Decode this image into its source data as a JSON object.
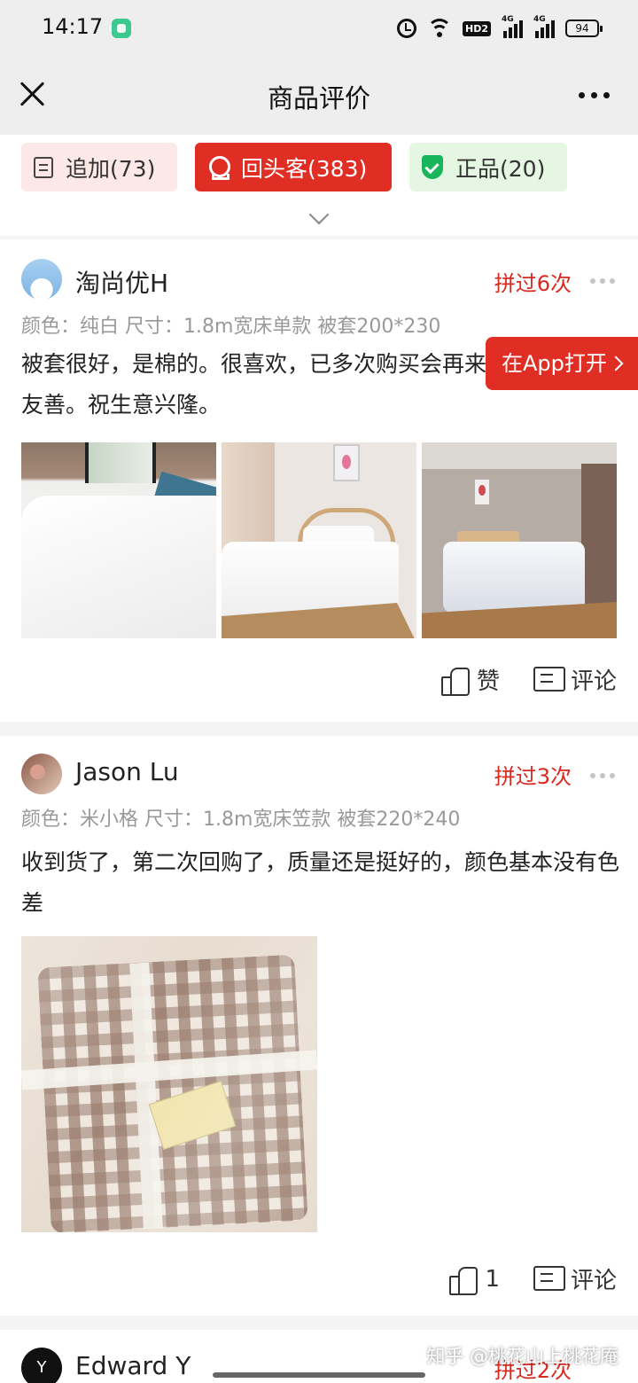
{
  "status_bar": {
    "time": "14:17",
    "hd_label": "HD2",
    "signal_label": "4G",
    "battery": "94"
  },
  "nav": {
    "title": "商品评价"
  },
  "tags": [
    {
      "label": "追加(73)"
    },
    {
      "label": "回头客(383)"
    },
    {
      "label": "正品(20)"
    }
  ],
  "open_in_app": "在App打开",
  "reviews": [
    {
      "user": "淘尚优H",
      "repeat": "拼过6次",
      "spec": "颜色：纯白 尺寸：1.8m宽床单款 被套200*230",
      "text": "被套很好，是棉的。很喜欢，已多次购买会再来的。老板态度友善。祝生意兴隆。",
      "like_label": "赞",
      "comment_label": "评论"
    },
    {
      "user": "Jason Lu",
      "repeat": "拼过3次",
      "spec": "颜色：米小格 尺寸：1.8m宽床笠款 被套220*240",
      "text": "收到货了，第二次回购了，质量还是挺好的，颜色基本没有色差",
      "like_label": "1",
      "comment_label": "评论"
    },
    {
      "user": "Edward Y",
      "repeat": "拼过2次",
      "avatar_letter": "Y"
    }
  ],
  "watermark": "知乎 @桃花山上桃花庵",
  "colors": {
    "accent_red": "#e02e24",
    "repeat_red": "#d92a20",
    "genuine_green": "#19b55a",
    "header_gray": "#eeeeee"
  },
  "icons": [
    "close-icon",
    "more-icon",
    "alarm-icon",
    "wifi-icon",
    "signal-icon",
    "battery-icon",
    "doc-icon",
    "medal-icon",
    "shield-check-icon",
    "chevron-down-icon",
    "thumbs-up-icon",
    "comment-icon"
  ]
}
